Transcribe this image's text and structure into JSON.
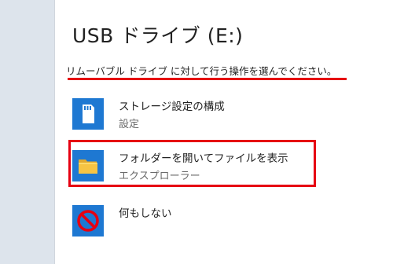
{
  "dialog": {
    "title": "USB ドライブ (E:)",
    "prompt": "リムーバブル ドライブ に対して行う操作を選んでください。"
  },
  "options": [
    {
      "label": "ストレージ設定の構成",
      "sub": "設定",
      "icon": "sd-card-icon"
    },
    {
      "label": "フォルダーを開いてファイルを表示",
      "sub": "エクスプローラー",
      "icon": "folder-icon"
    },
    {
      "label": "何もしない",
      "sub": "",
      "icon": "no-action-icon"
    }
  ],
  "colors": {
    "icon_bg": "#1e78d2",
    "highlight": "#e60012",
    "folder": "#f6c443"
  }
}
